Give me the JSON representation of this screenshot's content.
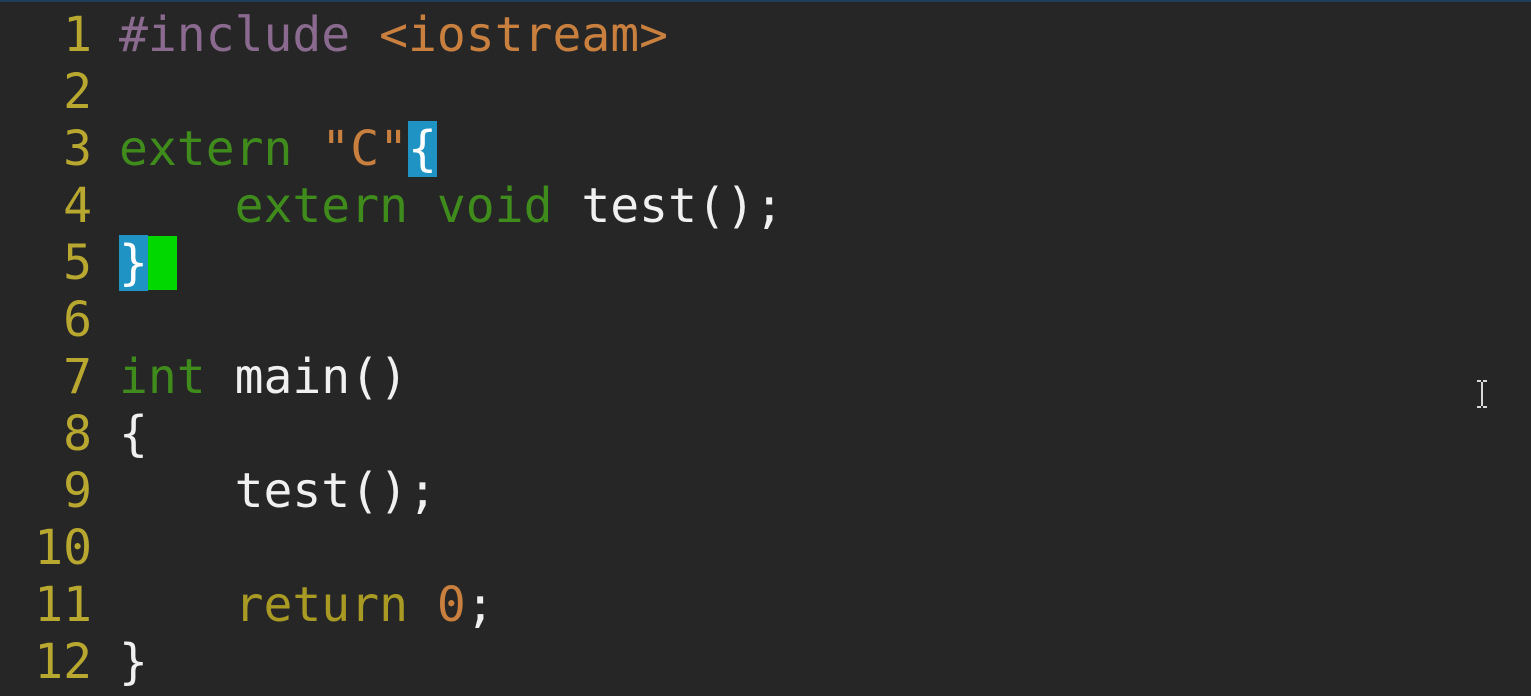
{
  "editor": {
    "lines": [
      {
        "num": "1",
        "tokens": [
          [
            "pp",
            "#include "
          ],
          [
            "str",
            "<iostream>"
          ]
        ]
      },
      {
        "num": "2",
        "tokens": []
      },
      {
        "num": "3",
        "tokens": [
          [
            "kw",
            "extern "
          ],
          [
            "str",
            "\"C\""
          ],
          [
            "match",
            "{"
          ]
        ]
      },
      {
        "num": "4",
        "tokens": [
          [
            "plain",
            "    "
          ],
          [
            "kw",
            "extern void "
          ],
          [
            "plain",
            "test();"
          ]
        ]
      },
      {
        "num": "5",
        "tokens": [
          [
            "match",
            "}"
          ],
          [
            "cursor",
            ""
          ]
        ]
      },
      {
        "num": "6",
        "tokens": []
      },
      {
        "num": "7",
        "tokens": [
          [
            "kw",
            "int "
          ],
          [
            "plain",
            "main()"
          ]
        ]
      },
      {
        "num": "8",
        "tokens": [
          [
            "plain",
            "{"
          ]
        ]
      },
      {
        "num": "9",
        "tokens": [
          [
            "plain",
            "    test();"
          ]
        ]
      },
      {
        "num": "10",
        "tokens": []
      },
      {
        "num": "11",
        "tokens": [
          [
            "plain",
            "    "
          ],
          [
            "ret",
            "return "
          ],
          [
            "num",
            "0"
          ],
          [
            "plain",
            ";"
          ]
        ]
      },
      {
        "num": "12",
        "tokens": [
          [
            "plain",
            "}"
          ]
        ]
      }
    ]
  },
  "colors": {
    "background": "#262626",
    "line_number": "#b8a830",
    "preprocessor": "#8a6a8e",
    "string": "#c9803f",
    "keyword": "#3f8c1c",
    "return_keyword": "#a99a24",
    "bracket_match": "#1f94c4",
    "cursor": "#00d800"
  },
  "icons": {
    "mouse_pointer": "text-cursor-ibeam-icon"
  }
}
